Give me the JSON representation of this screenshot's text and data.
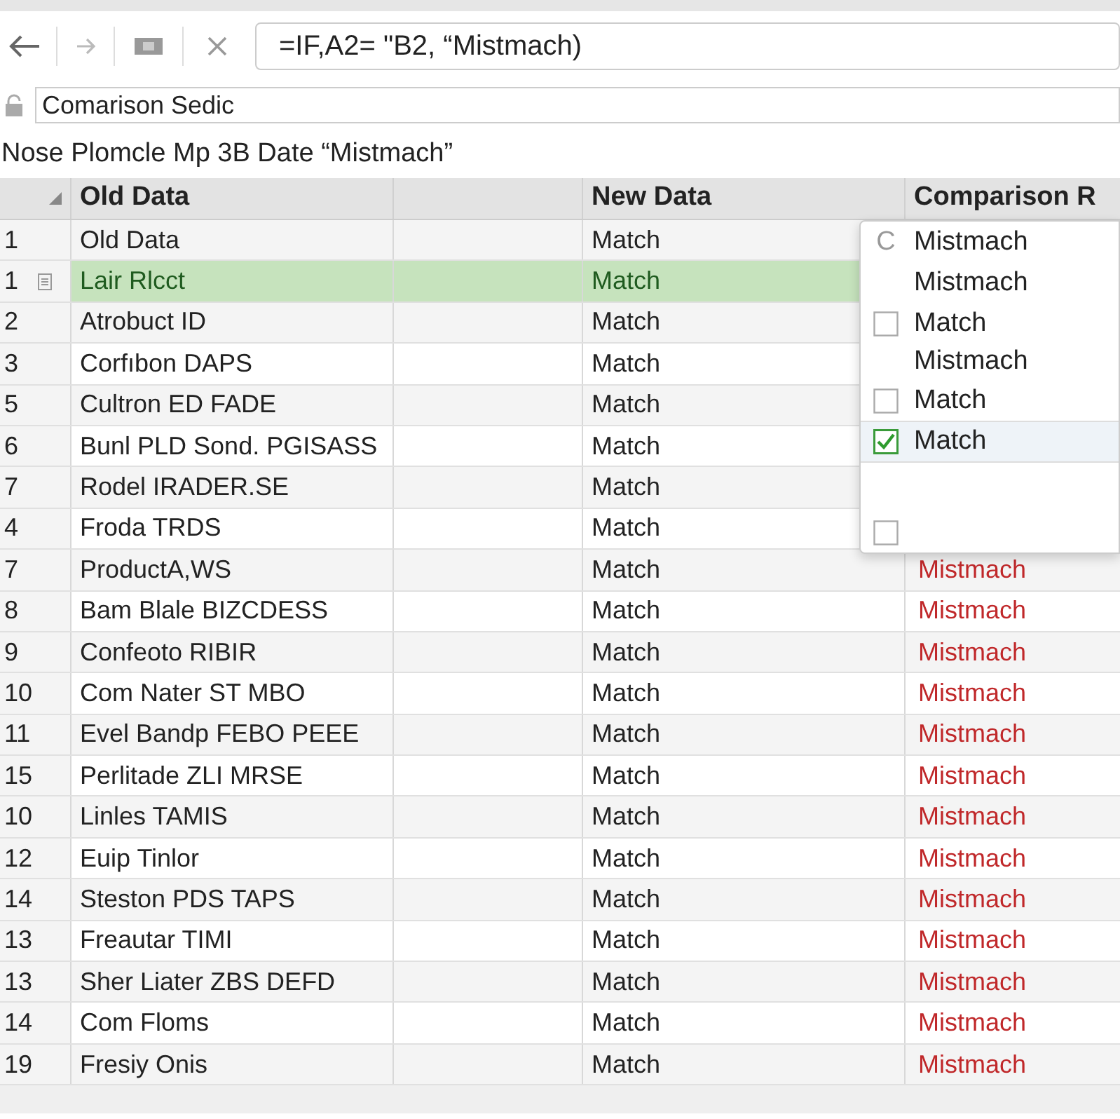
{
  "toolbar": {
    "formula": "=IF,A2= \"B2, “Mistmach)"
  },
  "name_box": {
    "value": "Comarison Sedic"
  },
  "caption": "Nose Plomcle Mp 3B Date “Mistmach”",
  "table": {
    "columns": [
      "Old Data",
      "",
      "New Data",
      "Comparison R"
    ],
    "rows": [
      {
        "num": "1",
        "old": "Old Data",
        "new": "Match",
        "selected": false
      },
      {
        "num": "1",
        "old": "Lair Rlcct",
        "new": "Match",
        "selected": true
      },
      {
        "num": "2",
        "old": "Atrobuct ID",
        "new": "Match",
        "selected": false
      },
      {
        "num": "3",
        "old": "Corfıbon DAPS",
        "new": "Match",
        "selected": false
      },
      {
        "num": "5",
        "old": "Cultron ED FADE",
        "new": "Match",
        "selected": false
      },
      {
        "num": "6",
        "old": "Bunl PLD Sond. PGISASS",
        "new": "Match",
        "selected": false
      },
      {
        "num": "7",
        "old": "Rodel IRADER.SE",
        "new": "Match",
        "selected": false
      },
      {
        "num": "4",
        "old": "Froda TRDS",
        "new": "Match",
        "selected": false
      },
      {
        "num": "7",
        "old": "ProductA,WS",
        "new": "Match",
        "result": "Mistmach",
        "selected": false
      },
      {
        "num": "8",
        "old": "Bam Blale BIZCDESS",
        "new": "Match",
        "result": "Mistmach",
        "selected": false
      },
      {
        "num": "9",
        "old": "Confeoto RIBIR",
        "new": "Match",
        "result": "Mistmach",
        "selected": false
      },
      {
        "num": "10",
        "old": "Com Nater ST MBO",
        "new": "Match",
        "result": "Mistmach",
        "selected": false
      },
      {
        "num": "11",
        "old": "Evel Bandp FEBO PEEE",
        "new": "Match",
        "result": "Mistmach",
        "selected": false
      },
      {
        "num": "15",
        "old": "Perlitade ZLI MRSE",
        "new": "Match",
        "result": "Mistmach",
        "selected": false
      },
      {
        "num": "10",
        "old": "Linles TAMIS",
        "new": "Match",
        "result": "Mistmach",
        "selected": false
      },
      {
        "num": "12",
        "old": "Euip Tinlor",
        "new": "Match",
        "result": "Mistmach",
        "selected": false
      },
      {
        "num": "14",
        "old": "Steston PDS TAPS",
        "new": "Match",
        "result": "Mistmach",
        "selected": false
      },
      {
        "num": "13",
        "old": "Freautar TIMI",
        "new": "Match",
        "result": "Mistmach",
        "selected": false
      },
      {
        "num": "13",
        "old": "Sher Liater ZBS DEFD",
        "new": "Match",
        "result": "Mistmach",
        "selected": false
      },
      {
        "num": "14",
        "old": "Com Floms",
        "new": "Match",
        "result": "Mistmach",
        "selected": false
      },
      {
        "num": "19",
        "old": "Fresiy Onis",
        "new": "Match",
        "result": "Mistmach",
        "selected": false
      }
    ]
  },
  "dropdown": {
    "items": [
      {
        "kind": "letter",
        "mark": "C",
        "label": "Mistmach",
        "selected": false
      },
      {
        "kind": "plain",
        "label": "Mistmach",
        "selected": false
      },
      {
        "kind": "checkbox",
        "checked": false,
        "label": "Match",
        "selected": false
      },
      {
        "kind": "plain",
        "label": "Mistmach",
        "selected": false
      },
      {
        "kind": "checkbox",
        "checked": false,
        "label": "Match",
        "selected": false
      },
      {
        "kind": "checkbox",
        "checked": true,
        "label": "Match",
        "selected": true
      },
      {
        "kind": "checkbox",
        "checked": false,
        "selected": false
      }
    ]
  }
}
